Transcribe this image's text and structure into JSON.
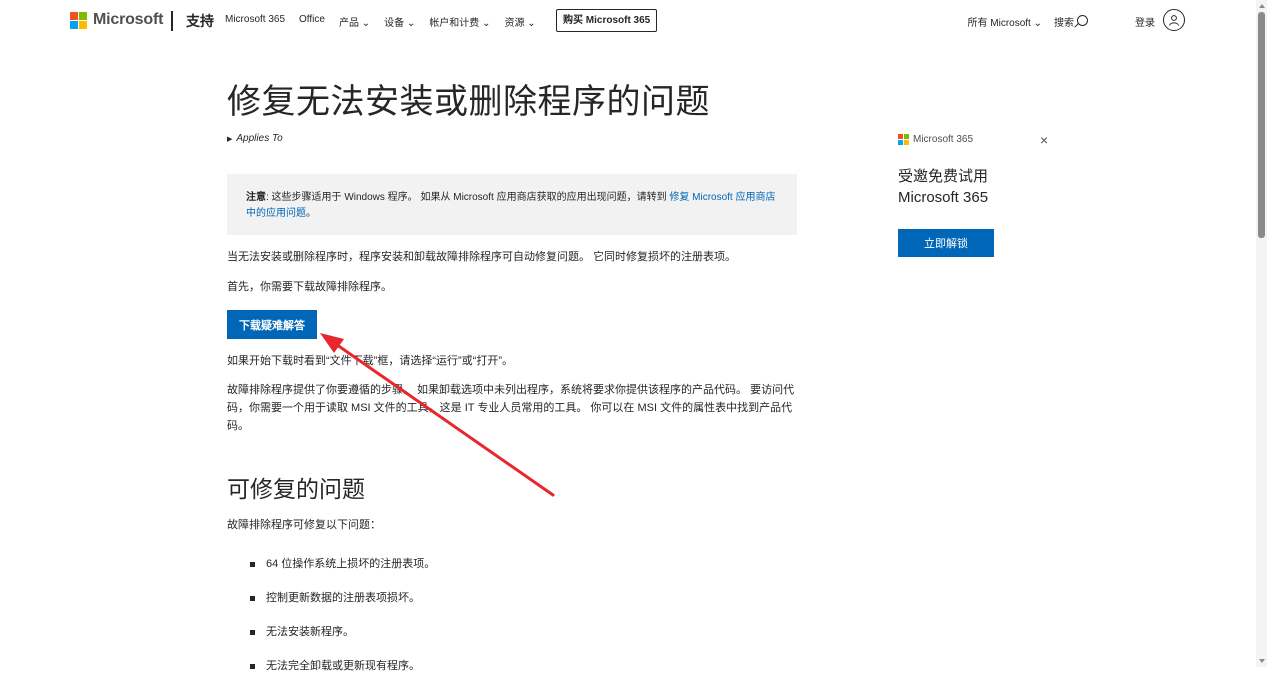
{
  "header": {
    "brand": "Microsoft",
    "section": "支持",
    "nav": [
      "Microsoft 365",
      "Office",
      "产品 ⌄",
      "设备 ⌄",
      "帐户和计费 ⌄",
      "资源 ⌄"
    ],
    "buy_label": "购买 Microsoft 365",
    "all_ms": "所有 Microsoft ⌄",
    "search_label": "搜索",
    "signin_label": "登录",
    "logo_colors": [
      "#f25022",
      "#7fba00",
      "#00a4ef",
      "#ffb900"
    ]
  },
  "main": {
    "title": "修复无法安装或删除程序的问题",
    "applies_to": "Applies To",
    "note_label": "注意",
    "note_text": ": 这些步骤适用于 Windows 程序。 如果从 Microsoft 应用商店获取的应用出现问题，请转到 ",
    "note_link": "修复 Microsoft 应用商店中的应用问题",
    "note_end": "。",
    "p1": "当无法安装或删除程序时，程序安装和卸载故障排除程序可自动修复问题。 它同时修复损坏的注册表项。",
    "p2": "首先，你需要下载故障排除程序。",
    "download_label": "下载疑难解答",
    "p3": "如果开始下载时看到“文件下载”框，请选择“运行”或“打开”。",
    "p4": "故障排除程序提供了你要遵循的步骤。 如果卸载选项中未列出程序，系统将要求你提供该程序的产品代码。 要访问代码，你需要一个用于读取 MSI 文件的工具，这是 IT 专业人员常用的工具。 你可以在 MSI 文件的属性表中找到产品代码。",
    "h2": "可修复的问题",
    "p5": "故障排除程序可修复以下问题：",
    "bullets": [
      "64 位操作系统上损坏的注册表项。",
      "控制更新数据的注册表项损坏。",
      "无法安装新程序。",
      "无法完全卸载或更新现有程序。"
    ]
  },
  "side": {
    "brand": "Microsoft 365",
    "close": "×",
    "title": "受邀免费试用 Microsoft 365",
    "unlock_label": "立即解锁"
  },
  "colors": {
    "accent": "#0067b8",
    "annotation": "#e8262b"
  }
}
